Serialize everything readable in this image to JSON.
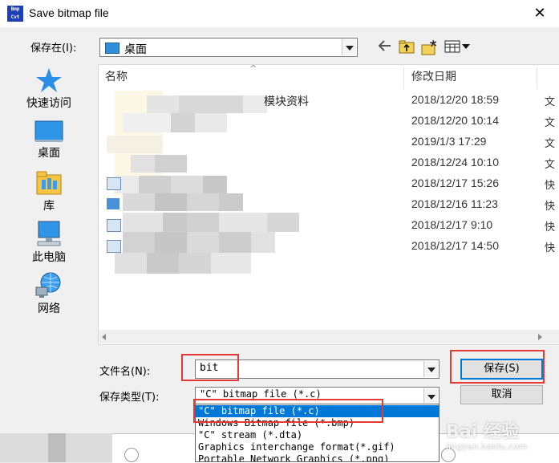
{
  "window": {
    "title": "Save bitmap file",
    "app_icon_text": "Bmp Cvt",
    "close_glyph": "✕"
  },
  "save_in": {
    "label": "保存在(I):",
    "value": "桌面"
  },
  "toolbar": {
    "icons": [
      "back-arrow-icon",
      "up-folder-icon",
      "new-folder-icon",
      "view-menu-icon"
    ]
  },
  "places": [
    {
      "id": "quick-access",
      "label": "快速访问",
      "icon": "star-icon"
    },
    {
      "id": "desktop",
      "label": "桌面",
      "icon": "desktop-icon"
    },
    {
      "id": "libraries",
      "label": "库",
      "icon": "library-icon"
    },
    {
      "id": "this-pc",
      "label": "此电脑",
      "icon": "computer-icon"
    },
    {
      "id": "network",
      "label": "网络",
      "icon": "network-icon"
    }
  ],
  "filelist": {
    "columns": {
      "name": "名称",
      "date": "修改日期"
    },
    "rows": [
      {
        "name": "模块资料",
        "date": "2018/12/20 18:59",
        "type": "文"
      },
      {
        "name": "",
        "date": "2018/12/20 10:14",
        "type": "文"
      },
      {
        "name": "",
        "date": "2019/1/3 17:29",
        "type": "文"
      },
      {
        "name": "",
        "date": "2018/12/24 10:10",
        "type": "文"
      },
      {
        "name": "",
        "date": "2018/12/17 15:26",
        "type": "快"
      },
      {
        "name": "",
        "date": "2018/12/16 11:23",
        "type": "快"
      },
      {
        "name": "",
        "date": "2018/12/17 9:10",
        "type": "快"
      },
      {
        "name": "",
        "date": "2018/12/17 14:50",
        "type": "快"
      }
    ]
  },
  "filename": {
    "label": "文件名(N):",
    "value": "bit"
  },
  "filetype": {
    "label": "保存类型(T):",
    "value": "\"C\" bitmap file (*.c)",
    "options": [
      "\"C\" bitmap file (*.c)",
      "Windows Bitmap file (*.bmp)",
      "\"C\" stream (*.dta)",
      "Graphics interchange format(*.gif)",
      "Portable Network Graphics (*.png)"
    ],
    "selected_index": 0
  },
  "buttons": {
    "save": "保存(S)",
    "cancel": "取消"
  },
  "watermark": {
    "text": "Bai 经验",
    "sub": "jingyan.baidu.com"
  },
  "colors": {
    "highlight": "#0078d7",
    "annotation": "#e53935"
  }
}
